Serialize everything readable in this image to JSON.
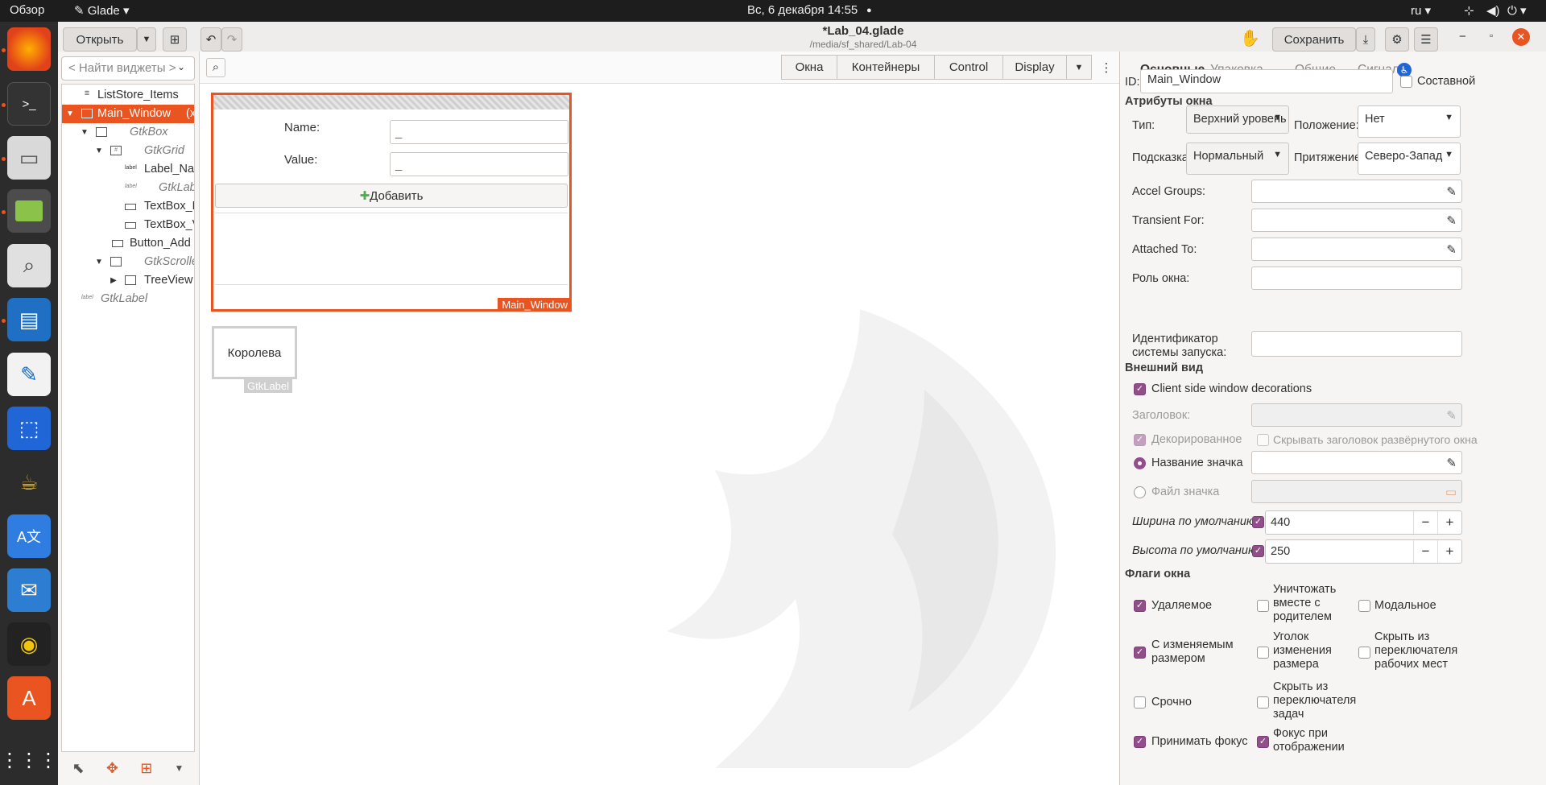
{
  "topbar": {
    "overview": "Обзор",
    "app": "Glade",
    "clock": "Вс, 6 декабря  14:55",
    "lang": "ru"
  },
  "header": {
    "open": "Открыть",
    "title": "*Lab_04.glade",
    "subtitle": "/media/sf_shared/Lab-04",
    "save": "Сохранить"
  },
  "leftpane": {
    "search_placeholder": "< Найти виджеты >",
    "tree": [
      {
        "label": "ListStore_Items",
        "italic": false,
        "selected": false,
        "icon": "list-store-icon"
      },
      {
        "label": "Main_Window",
        "italic": false,
        "selected": true,
        "icon": "window-icon",
        "suffix": "(x"
      },
      {
        "label": "GtkBox",
        "italic": true,
        "selected": false,
        "icon": "box-icon"
      },
      {
        "label": "GtkGrid",
        "italic": true,
        "selected": false,
        "icon": "grid-icon"
      },
      {
        "label": "Label_Name",
        "italic": false,
        "selected": false,
        "icon": "label-icon"
      },
      {
        "label": "GtkLabel",
        "italic": true,
        "selected": false,
        "icon": "label-icon"
      },
      {
        "label": "TextBox_Name",
        "italic": false,
        "selected": false,
        "icon": "entry-icon"
      },
      {
        "label": "TextBox_Value",
        "italic": false,
        "selected": false,
        "icon": "entry-icon"
      },
      {
        "label": "Button_Add",
        "italic": false,
        "selected": false,
        "icon": "button-icon"
      },
      {
        "label": "GtkScrolledWindow",
        "italic": true,
        "selected": false,
        "icon": "scrolled-icon"
      },
      {
        "label": "TreeView",
        "italic": false,
        "selected": false,
        "icon": "treeview-icon"
      },
      {
        "label": "GtkLabel",
        "italic": true,
        "selected": false,
        "icon": "label-icon"
      }
    ]
  },
  "canvas": {
    "tabs": [
      "Окна",
      "Контейнеры",
      "Control",
      "Display"
    ],
    "mainwin": {
      "name_label": "Name:",
      "value_label": "Value:",
      "add_button": "Добавить",
      "tag": "Main_Window"
    },
    "label_widget": {
      "text": "Королева",
      "tag": "GtkLabel"
    }
  },
  "props": {
    "tabs": [
      "Основные",
      "Упаковка",
      "Общие",
      "Сигналы"
    ],
    "id_label": "ID:",
    "id_value": "Main_Window",
    "composite": "Составной",
    "sec_window": "Атрибуты окна",
    "type_label": "Тип:",
    "type_value": "Верхний уровень",
    "position_label": "Положение:",
    "position_value": "Нет",
    "hint_label": "Подсказка:",
    "hint_value": "Нормальный",
    "gravity_label": "Притяжение:",
    "gravity_value": "Северо-Запад",
    "accel": "Accel Groups:",
    "transient": "Transient For:",
    "attached": "Attached To:",
    "role": "Роль окна:",
    "startup": "Идентификатор системы запуска:",
    "sec_appearance": "Внешний вид",
    "csd": "Client side window decorations",
    "title_label": "Заголовок:",
    "decorated": "Декорированное",
    "hide_titlebar": "Скрывать заголовок развёрнутого окна",
    "icon_name": "Название значка",
    "icon_file": "Файл значка",
    "width_label": "Ширина по умолчанию:",
    "width_value": "440",
    "height_label": "Высота по умолчанию:",
    "height_value": "250",
    "sec_flags": "Флаги окна",
    "flags": [
      {
        "label": "Удаляемое",
        "on": true
      },
      {
        "label": "Уничтожать вместе с родителем",
        "on": false
      },
      {
        "label": "Модальное",
        "on": false
      },
      {
        "label": "С изменяемым размером",
        "on": true
      },
      {
        "label": "Уголок изменения размера",
        "on": false
      },
      {
        "label": "Скрыть из переключателя рабочих мест",
        "on": false
      },
      {
        "label": "Срочно",
        "on": false
      },
      {
        "label": "Скрыть из переключателя задач",
        "on": false
      },
      {
        "label": "Принимать фокус",
        "on": true
      },
      {
        "label": "Фокус при отображении",
        "on": true
      }
    ]
  }
}
